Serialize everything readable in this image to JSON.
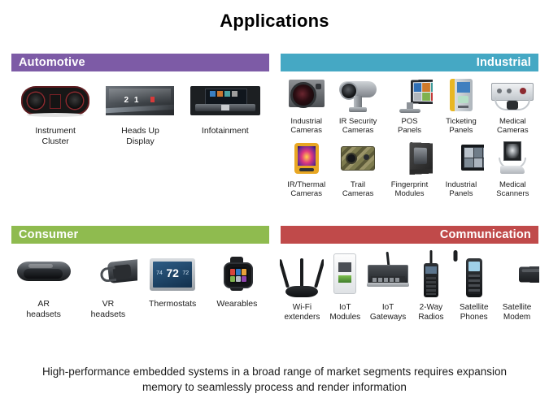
{
  "title": "Applications",
  "colors": {
    "automotive": "#7d5ba6",
    "industrial": "#45a8c4",
    "consumer": "#8fbb4f",
    "communication": "#c04a4a",
    "text": "#1b1b1b"
  },
  "sections": [
    {
      "key": "automotive",
      "label": "Automotive",
      "align": "left",
      "color": "#7d5ba6",
      "rows": [
        {
          "items": [
            {
              "label": "Instrument\nCluster",
              "icon": "instrument-cluster-image"
            },
            {
              "label": "Heads Up\nDisplay",
              "icon": "heads-up-display-image"
            },
            {
              "label": "Infotainment",
              "icon": "infotainment-image"
            }
          ]
        }
      ]
    },
    {
      "key": "industrial",
      "label": "Industrial",
      "align": "right",
      "color": "#45a8c4",
      "rows": [
        {
          "items": [
            {
              "label": "Industrial\nCameras",
              "icon": "industrial-camera-image"
            },
            {
              "label": "IR Security\nCameras",
              "icon": "ir-security-camera-image"
            },
            {
              "label": "POS\nPanels",
              "icon": "pos-panel-image"
            },
            {
              "label": "Ticketing\nPanels",
              "icon": "ticketing-panel-image"
            },
            {
              "label": "Medical\nCameras",
              "icon": "medical-camera-image"
            }
          ]
        },
        {
          "items": [
            {
              "label": "IR/Thermal\nCameras",
              "icon": "ir-thermal-camera-image"
            },
            {
              "label": "Trail\nCameras",
              "icon": "trail-camera-image"
            },
            {
              "label": "Fingerprint\nModules",
              "icon": "fingerprint-module-image"
            },
            {
              "label": "Industrial\nPanels",
              "icon": "industrial-panel-image"
            },
            {
              "label": "Medical\nScanners",
              "icon": "medical-scanner-image"
            }
          ]
        }
      ]
    },
    {
      "key": "consumer",
      "label": "Consumer",
      "align": "left",
      "color": "#8fbb4f",
      "rows": [
        {
          "items": [
            {
              "label": "AR\nheadsets",
              "icon": "ar-headset-image"
            },
            {
              "label": "VR\nheadsets",
              "icon": "vr-headset-image"
            },
            {
              "label": "Thermostats",
              "icon": "thermostat-image"
            },
            {
              "label": "Wearables",
              "icon": "wearable-watch-image"
            }
          ]
        }
      ]
    },
    {
      "key": "communication",
      "label": "Communication",
      "align": "right",
      "color": "#c04a4a",
      "rows": [
        {
          "items": [
            {
              "label": "Wi-Fi\nextenders",
              "icon": "wifi-extender-image"
            },
            {
              "label": "IoT\nModules",
              "icon": "iot-module-image"
            },
            {
              "label": "IoT\nGateways",
              "icon": "iot-gateway-image"
            },
            {
              "label": "2-Way\nRadios",
              "icon": "two-way-radio-image"
            },
            {
              "label": "Satellite\nPhones",
              "icon": "satellite-phone-image"
            },
            {
              "label": "Satellite\nModem",
              "icon": "satellite-modem-image"
            }
          ]
        }
      ]
    }
  ],
  "thermostat_display": {
    "temperature": "72",
    "left_small": "74",
    "right_small": "72"
  },
  "hud_display": {
    "value": "2 1"
  },
  "caption": "High-performance embedded systems in a broad range of market segments requires expansion memory to seamlessly process and render information"
}
